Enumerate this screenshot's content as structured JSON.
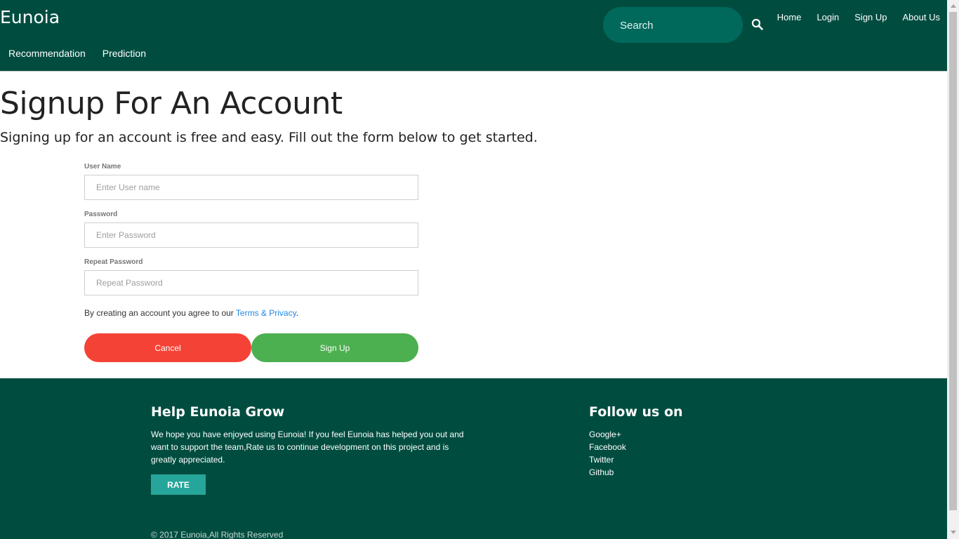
{
  "header": {
    "brand": "Eunoia",
    "search_placeholder": "Search",
    "top_links": [
      "Home",
      "Login",
      "Sign Up",
      "About Us"
    ],
    "sub_links": [
      "Recommendation",
      "Prediction"
    ]
  },
  "main": {
    "title": "Signup For An Account",
    "subtitle": "Signing up for an account is free and easy. Fill out the form below to get started.",
    "fields": [
      {
        "label": "User Name",
        "placeholder": "Enter User name",
        "value": ""
      },
      {
        "label": "Password",
        "placeholder": "Enter Password",
        "value": ""
      },
      {
        "label": "Repeat Password",
        "placeholder": "Repeat Password",
        "value": ""
      }
    ],
    "terms_prefix": "By creating an account you agree to our ",
    "terms_link": "Terms & Privacy",
    "terms_suffix": ".",
    "cancel_label": "Cancel",
    "signup_label": "Sign Up"
  },
  "footer": {
    "grow_title": "Help Eunoia Grow",
    "grow_text": "We hope you have enjoyed using Eunoia! If you feel Eunoia has helped you out and want to support the team,Rate us to continue development on this project and is greatly appreciated.",
    "rate_label": "RATE",
    "follow_title": "Follow us on",
    "follow_items": [
      "Google+",
      "Facebook",
      "Twitter",
      "Github"
    ],
    "copyright": "© 2017 Eunoia,All Rights Reserved"
  },
  "colors": {
    "header_bg": "#004d40",
    "search_bg": "#00695c",
    "cancel_btn": "#f44336",
    "signup_btn": "#4caf50",
    "rate_btn": "#26a69a",
    "link": "#1e88e5"
  },
  "icons": {
    "search": "search-icon"
  }
}
